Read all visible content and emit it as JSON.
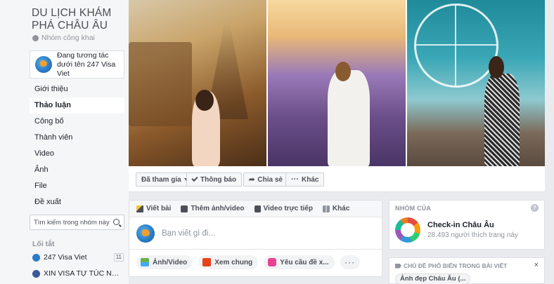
{
  "group": {
    "name": "DU LỊCH KHÁM PHÁ CHÂU ÂU",
    "privacy": "Nhóm công khai",
    "acting_as": "Đang tương tác dưới tên 247 Visa Viet"
  },
  "nav": {
    "items": [
      {
        "label": "Giới thiệu",
        "active": false
      },
      {
        "label": "Thảo luận",
        "active": true
      },
      {
        "label": "Công bố",
        "active": false
      },
      {
        "label": "Thành viên",
        "active": false
      },
      {
        "label": "Video",
        "active": false
      },
      {
        "label": "Ảnh",
        "active": false
      },
      {
        "label": "File",
        "active": false
      },
      {
        "label": "Đề xuất",
        "active": false
      }
    ]
  },
  "search": {
    "placeholder": "Tìm kiếm trong nhóm này"
  },
  "shortcuts": {
    "title": "Lối tắt",
    "items": [
      {
        "label": "247 Visa Viet",
        "count": "11"
      },
      {
        "label": "XIN VISA TỰ TÚC NHẬ..."
      }
    ]
  },
  "actions": {
    "joined": "Đã tham gia",
    "notifications": "Thông báo",
    "share": "Chia sẻ",
    "more": "Khác"
  },
  "composer": {
    "tabs": [
      "Viết bài",
      "Thêm ảnh/video",
      "Video trực tiếp",
      "Khác"
    ],
    "placeholder": "Bạn viết gì đi...",
    "options": [
      "Ảnh/Video",
      "Xem chung",
      "Yêu cầu đề x..."
    ],
    "more": "···"
  },
  "related": {
    "header": "NHÓM CỦA",
    "page_name": "Check-in Châu Âu",
    "likes": "28.493 người thích trang này",
    "help": "?"
  },
  "topics": {
    "header": "CHỦ ĐỀ PHỔ BIẾN TRONG BÀI VIẾT",
    "close": "×",
    "chip": "Ảnh đẹp Châu Âu (..."
  },
  "colors": {
    "background": "#e9ebee",
    "sidebar": "#f5f6f7",
    "text": "#1d2129",
    "muted": "#90949c"
  }
}
